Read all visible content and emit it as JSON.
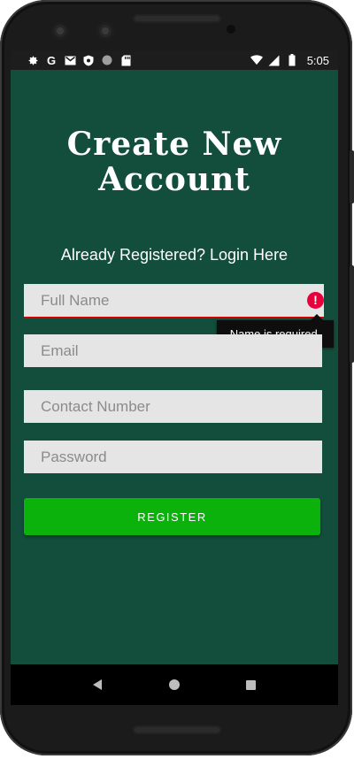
{
  "status_bar": {
    "left_icons": [
      "settings-icon",
      "google-icon",
      "gmail-icon",
      "shield-icon",
      "circle-icon",
      "sd-card-icon"
    ],
    "right_icons": [
      "wifi-icon",
      "signal-icon",
      "battery-icon"
    ],
    "time": "5:05"
  },
  "screen": {
    "background_color": "#124e3b",
    "title": "Create New\nAccount",
    "login_link": "Already Registered? Login Here",
    "fields": {
      "full_name": {
        "value": "",
        "placeholder": "Full Name"
      },
      "email": {
        "value": "",
        "placeholder": "Email"
      },
      "contact": {
        "value": "",
        "placeholder": "Contact Number"
      },
      "password": {
        "value": "",
        "placeholder": "Password"
      }
    },
    "error": {
      "icon": "!",
      "message": "Name is required.",
      "color": "#e8003d"
    },
    "register_label": "REGISTER",
    "register_color": "#0bb20b"
  },
  "nav_bar": {
    "buttons": [
      "back-icon",
      "home-icon",
      "recents-icon"
    ]
  }
}
